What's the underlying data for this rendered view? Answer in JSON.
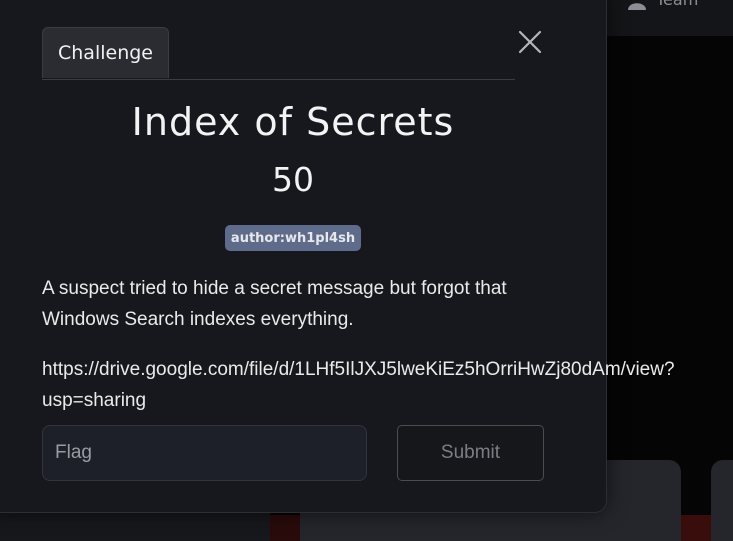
{
  "background": {
    "team_label": "Team",
    "icons": [
      "user-icon"
    ]
  },
  "modal": {
    "tab_label": "Challenge",
    "title": "Index of Secrets",
    "points": "50",
    "tag": "author:wh1pl4sh",
    "description": "A suspect tried to hide a secret message but forgot that Windows Search indexes everything.",
    "link_text": "https://drive.google.com/file/d/1LHf5IlJXJ5lweKiEz5hOrriHwZj80dAm/view?usp=sharing",
    "flag_placeholder": "Flag",
    "flag_value": "",
    "submit_label": "Submit",
    "close_icon": "close-icon"
  },
  "colors": {
    "modal_bg": "#17181d",
    "tag_bg": "#5e6b8a",
    "input_bg": "#1e2029"
  }
}
